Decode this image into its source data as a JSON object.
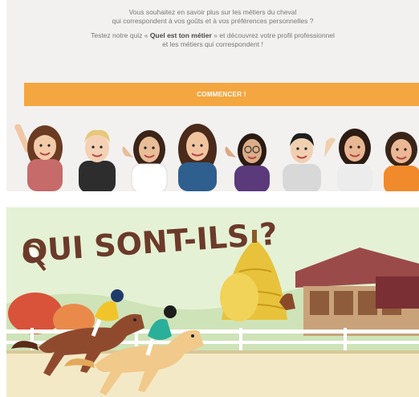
{
  "quiz": {
    "line1": "Vous souhaitez en savoir plus sur les métiers du cheval",
    "line2": "qui correspondent à vos goûts et à vos préférences personnelles ?",
    "line3_pre": "Testez notre quiz « ",
    "line3_bold": "Quel est ton métier",
    "line3_post": " » et découvrez votre profil professionnel",
    "line4": "et les métiers qui correspondent !",
    "start_label": "COMMENCER !",
    "accent": "#f4a640"
  },
  "banner": {
    "title": "QUI SONT-ILS ?"
  }
}
